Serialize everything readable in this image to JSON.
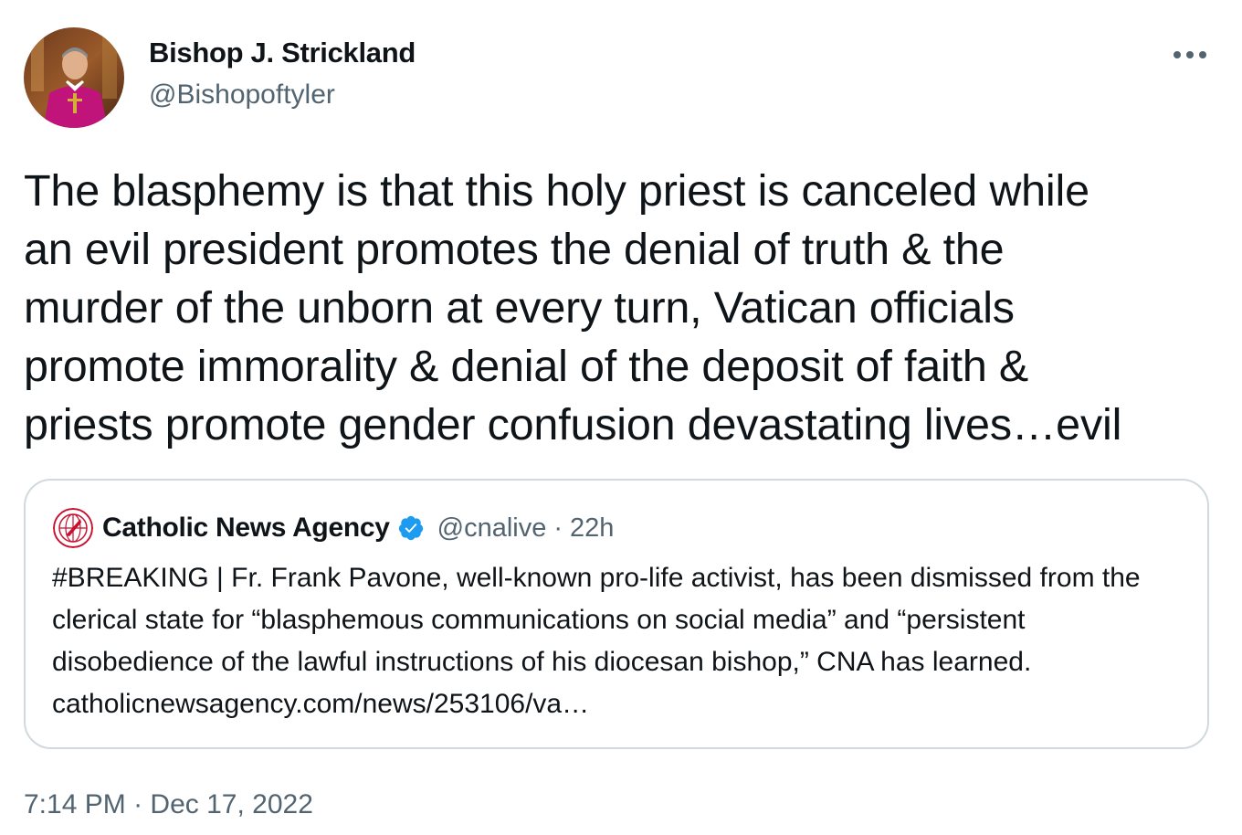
{
  "author": {
    "name": "Bishop J. Strickland",
    "handle": "@Bishopoftyler"
  },
  "tweet": {
    "text": "The blasphemy is that this holy priest is canceled while\nan evil president promotes the denial of truth & the\nmurder of the unborn at every turn, Vatican officials\npromote immorality & denial of the deposit of faith &\npriests promote gender confusion devastating lives…evil",
    "time": "7:14 PM",
    "separator": "·",
    "date": "Dec 17, 2022"
  },
  "quoted_tweet": {
    "name": "Catholic News Agency",
    "handle": "@cnalive",
    "separator": "·",
    "time": "22h",
    "text": "#BREAKING | Fr. Frank Pavone, well-known pro-life activist, has been dismissed from the clerical state for “blasphemous communications on social media” and “persistent disobedience of the lawful instructions of his diocesan bishop,” CNA has learned.",
    "link": "catholicnewsagency.com/news/253106/va…"
  },
  "icons": {
    "more": "more-horizontal-icon",
    "verified": "verified-badge-icon"
  },
  "colors": {
    "text_primary": "#0f1419",
    "text_secondary": "#536471",
    "border": "#cfd9de",
    "verified": "#1d9bf0",
    "cna_red": "#c8102e"
  }
}
